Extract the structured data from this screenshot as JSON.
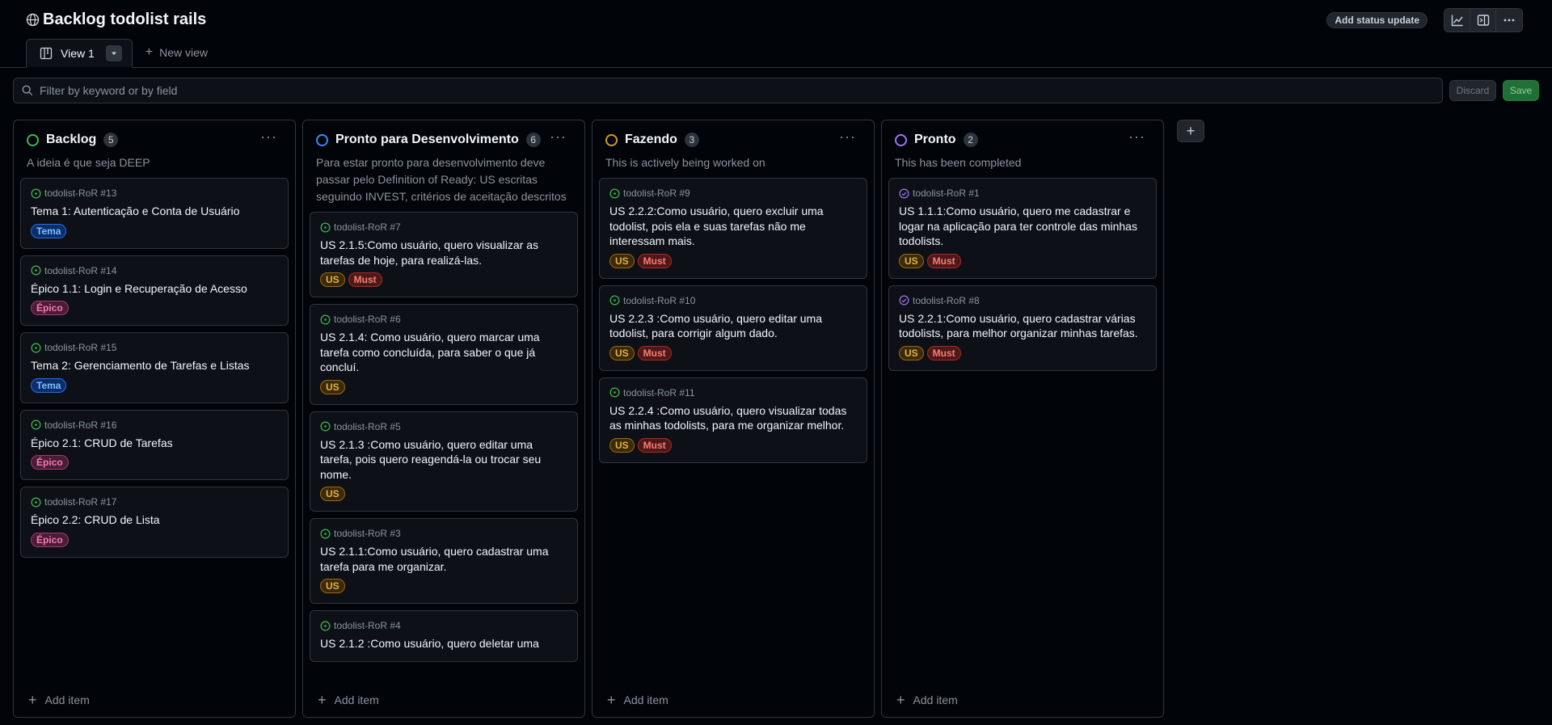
{
  "project": {
    "title": "Backlog todolist rails"
  },
  "header": {
    "status_button": "Add status update"
  },
  "tabs": [
    {
      "label": "View 1"
    }
  ],
  "new_view": "New view",
  "filter": {
    "placeholder": "Filter by keyword or by field",
    "discard": "Discard",
    "save": "Save"
  },
  "add_item_label": "Add item",
  "columns": [
    {
      "name": "Backlog",
      "count": "5",
      "color": "#3fb950",
      "description": "A ideia é que seja DEEP",
      "cards": [
        {
          "ref": "todolist-RoR #13",
          "title": "Tema 1: Autenticação e Conta de Usuário",
          "labels": [
            "Tema"
          ]
        },
        {
          "ref": "todolist-RoR #14",
          "title": "Épico 1.1: Login e Recuperação de Acesso",
          "labels": [
            "Épico"
          ]
        },
        {
          "ref": "todolist-RoR #15",
          "title": "Tema 2: Gerenciamento de Tarefas e Listas",
          "labels": [
            "Tema"
          ]
        },
        {
          "ref": "todolist-RoR #16",
          "title": "Épico 2.1: CRUD de Tarefas",
          "labels": [
            "Épico"
          ]
        },
        {
          "ref": "todolist-RoR #17",
          "title": "Épico 2.2: CRUD de Lista",
          "labels": [
            "Épico"
          ]
        }
      ]
    },
    {
      "name": "Pronto para Desenvolvimento",
      "count": "6",
      "color": "#388bfd",
      "description": "Para estar pronto para desenvolvimento deve passar pelo Definition of Ready: US escritas seguindo INVEST, critérios de aceitação descritos",
      "cards": [
        {
          "ref": "todolist-RoR #7",
          "title": "US 2.1.5:Como usuário, quero visualizar as tarefas de hoje, para realizá-las.",
          "labels": [
            "US",
            "Must"
          ]
        },
        {
          "ref": "todolist-RoR #6",
          "title": "US 2.1.4: Como usuário, quero marcar uma tarefa como concluída, para saber o que já concluí.",
          "labels": [
            "US"
          ]
        },
        {
          "ref": "todolist-RoR #5",
          "title": "US 2.1.3 :Como usuário, quero editar uma tarefa, pois quero reagendá-la ou trocar seu nome.",
          "labels": [
            "US"
          ]
        },
        {
          "ref": "todolist-RoR #3",
          "title": "US 2.1.1:Como usuário, quero cadastrar uma tarefa para me organizar.",
          "labels": [
            "US"
          ]
        },
        {
          "ref": "todolist-RoR #4",
          "title": "US 2.1.2 :Como usuário, quero deletar uma",
          "labels": []
        }
      ]
    },
    {
      "name": "Fazendo",
      "count": "3",
      "color": "#d29922",
      "description": "This is actively being worked on",
      "cards": [
        {
          "ref": "todolist-RoR #9",
          "title": "US 2.2.2:Como usuário, quero excluir uma todolist, pois ela e suas tarefas não me interessam mais.",
          "labels": [
            "US",
            "Must"
          ]
        },
        {
          "ref": "todolist-RoR #10",
          "title": "US 2.2.3 :Como usuário, quero editar uma todolist, para corrigir algum dado.",
          "labels": [
            "US",
            "Must"
          ]
        },
        {
          "ref": "todolist-RoR #11",
          "title": "US 2.2.4 :Como usuário, quero visualizar todas as minhas todolists, para me organizar melhor.",
          "labels": [
            "US",
            "Must"
          ]
        }
      ]
    },
    {
      "name": "Pronto",
      "count": "2",
      "color": "#a371f7",
      "description": "This has been completed",
      "cards": [
        {
          "ref": "todolist-RoR #1",
          "title": "US 1.1.1:Como usuário, quero me cadastrar e logar na aplicação para ter controle das minhas todolists.",
          "labels": [
            "US",
            "Must"
          ]
        },
        {
          "ref": "todolist-RoR #8",
          "title": "US 2.2.1:Como usuário, quero cadastrar várias todolists, para melhor organizar minhas tarefas.",
          "labels": [
            "US",
            "Must"
          ]
        }
      ]
    }
  ]
}
